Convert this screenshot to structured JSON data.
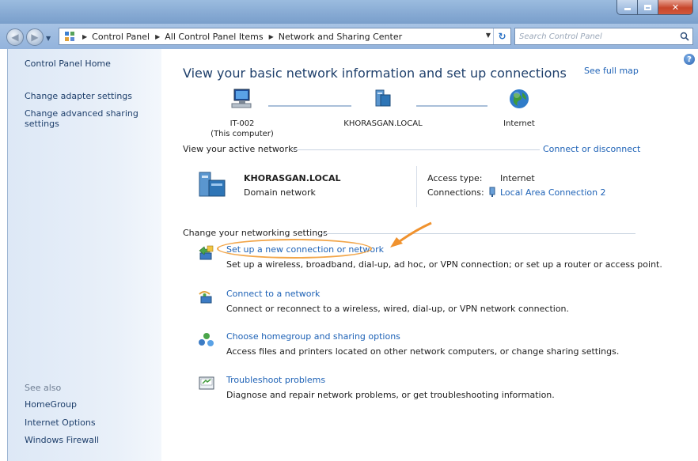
{
  "window": {
    "caption_buttons": {
      "minimize": "minimize-icon",
      "maximize": "maximize-icon",
      "close": "close-icon"
    }
  },
  "navigation": {
    "breadcrumbs": [
      "Control Panel",
      "All Control Panel Items",
      "Network and Sharing Center"
    ],
    "search_placeholder": "Search Control Panel"
  },
  "sidebar": {
    "home": "Control Panel Home",
    "tasks": [
      "Change adapter settings",
      "Change advanced sharing settings"
    ],
    "see_also_heading": "See also",
    "see_also": [
      "HomeGroup",
      "Internet Options",
      "Windows Firewall"
    ]
  },
  "main": {
    "title": "View your basic network information and set up connections",
    "see_full_map": "See full map",
    "map": {
      "computer_name": "IT-002",
      "computer_note": "(This computer)",
      "domain": "KHORASGAN.LOCAL",
      "internet": "Internet"
    },
    "active_networks": {
      "heading": "View your active networks",
      "connect_link": "Connect or disconnect",
      "network_name": "KHORASGAN.LOCAL",
      "network_type": "Domain network",
      "access_type_label": "Access type:",
      "access_type_value": "Internet",
      "connections_label": "Connections:",
      "connections_value": "Local Area Connection 2"
    },
    "change_settings": {
      "heading": "Change your networking settings",
      "tasks": [
        {
          "link": "Set up a new connection or network",
          "desc": "Set up a wireless, broadband, dial-up, ad hoc, or VPN connection; or set up a router or access point."
        },
        {
          "link": "Connect to a network",
          "desc": "Connect or reconnect to a wireless, wired, dial-up, or VPN network connection."
        },
        {
          "link": "Choose homegroup and sharing options",
          "desc": "Access files and printers located on other network computers, or change sharing settings."
        },
        {
          "link": "Troubleshoot problems",
          "desc": "Diagnose and repair network problems, or get troubleshooting information."
        }
      ]
    }
  },
  "colors": {
    "link": "#1e62b6",
    "title": "#1e3f6b",
    "annotation": "#f2a64a"
  }
}
